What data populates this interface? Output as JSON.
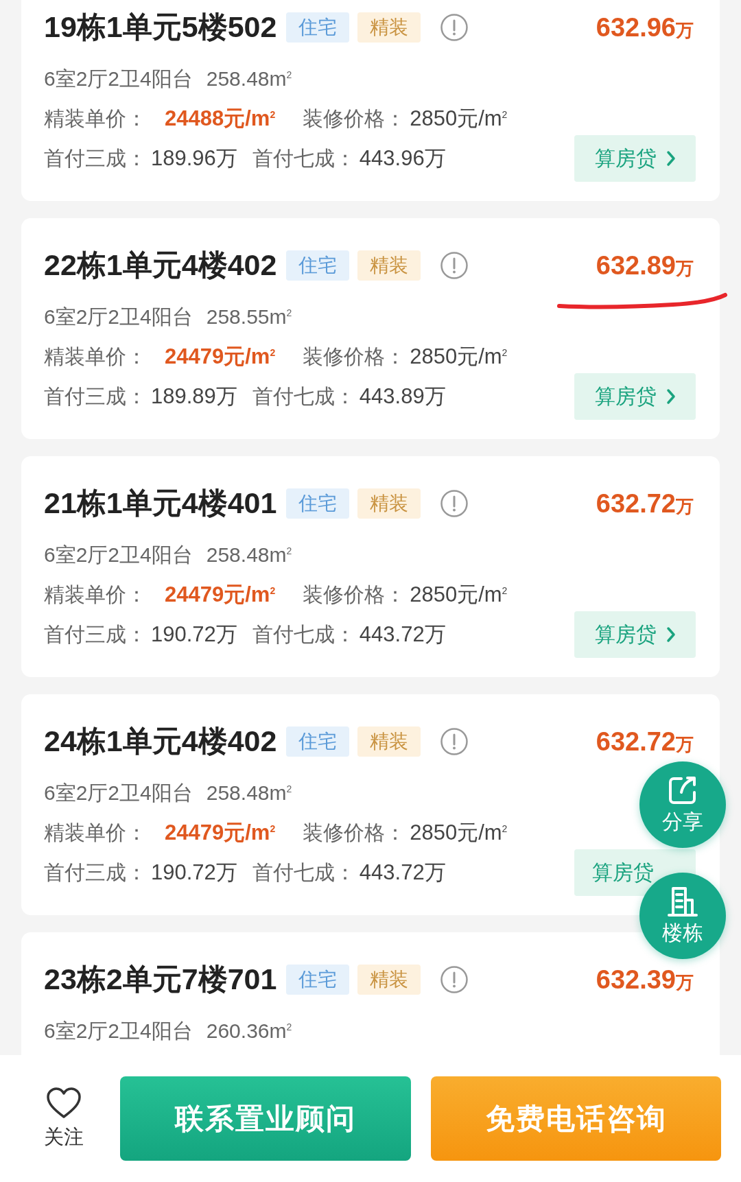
{
  "listings": [
    {
      "title": "19栋1单元5楼502",
      "tags": [
        {
          "label": "住宅",
          "kind": "type"
        },
        {
          "label": "精装",
          "kind": "finish"
        }
      ],
      "price": "632.96",
      "price_unit": "万",
      "annotated": false,
      "specs": "6室2厅2卫4阳台",
      "area": "258.48m$^{2}$",
      "unit_price_label": "精装单价：",
      "unit_price": "24488元/m$^{2}$",
      "renovation_label": "装修价格：",
      "renovation_price": "2850元/m$^{2}$",
      "down_30_label": "首付三成：",
      "down_30": "189.96万",
      "down_70_label": "首付七成：",
      "down_70": "443.96万",
      "loan_button": "算房贷"
    },
    {
      "title": "22栋1单元4楼402",
      "tags": [
        {
          "label": "住宅",
          "kind": "type"
        },
        {
          "label": "精装",
          "kind": "finish"
        }
      ],
      "price": "632.89",
      "price_unit": "万",
      "annotated": true,
      "specs": "6室2厅2卫4阳台",
      "area": "258.55m$^{2}$",
      "unit_price_label": "精装单价：",
      "unit_price": "24479元/m$^{2}$",
      "renovation_label": "装修价格：",
      "renovation_price": "2850元/m$^{2}$",
      "down_30_label": "首付三成：",
      "down_30": "189.89万",
      "down_70_label": "首付七成：",
      "down_70": "443.89万",
      "loan_button": "算房贷"
    },
    {
      "title": "21栋1单元4楼401",
      "tags": [
        {
          "label": "住宅",
          "kind": "type"
        },
        {
          "label": "精装",
          "kind": "finish"
        }
      ],
      "price": "632.72",
      "price_unit": "万",
      "annotated": false,
      "specs": "6室2厅2卫4阳台",
      "area": "258.48m$^{2}$",
      "unit_price_label": "精装单价：",
      "unit_price": "24479元/m$^{2}$",
      "renovation_label": "装修价格：",
      "renovation_price": "2850元/m$^{2}$",
      "down_30_label": "首付三成：",
      "down_30": "190.72万",
      "down_70_label": "首付七成：",
      "down_70": "443.72万",
      "loan_button": "算房贷"
    },
    {
      "title": "24栋1单元4楼402",
      "tags": [
        {
          "label": "住宅",
          "kind": "type"
        },
        {
          "label": "精装",
          "kind": "finish"
        }
      ],
      "price": "632.72",
      "price_unit": "万",
      "annotated": false,
      "specs": "6室2厅2卫4阳台",
      "area": "258.48m$^{2}$",
      "unit_price_label": "精装单价：",
      "unit_price": "24479元/m$^{2}$",
      "renovation_label": "装修价格：",
      "renovation_price": "2850元/m$^{2}$",
      "down_30_label": "首付三成：",
      "down_30": "190.72万",
      "down_70_label": "首付七成：",
      "down_70": "443.72万",
      "loan_button": "算房贷",
      "loan_chevron": false
    },
    {
      "title": "23栋2单元7楼701",
      "tags": [
        {
          "label": "住宅",
          "kind": "type"
        },
        {
          "label": "精装",
          "kind": "finish"
        }
      ],
      "price": "632.39",
      "price_unit": "万",
      "annotated": false,
      "specs": "6室2厅2卫4阳台",
      "area": "260.36m$^{2}$"
    }
  ],
  "floating_buttons": [
    {
      "label": "分享",
      "kind": "share"
    },
    {
      "label": "楼栋",
      "kind": "building"
    }
  ],
  "bottom_bar": {
    "follow": {
      "label": "关注",
      "selected": false
    },
    "contact_button": "联系置业顾问",
    "call_button": "免费电话咨询"
  }
}
